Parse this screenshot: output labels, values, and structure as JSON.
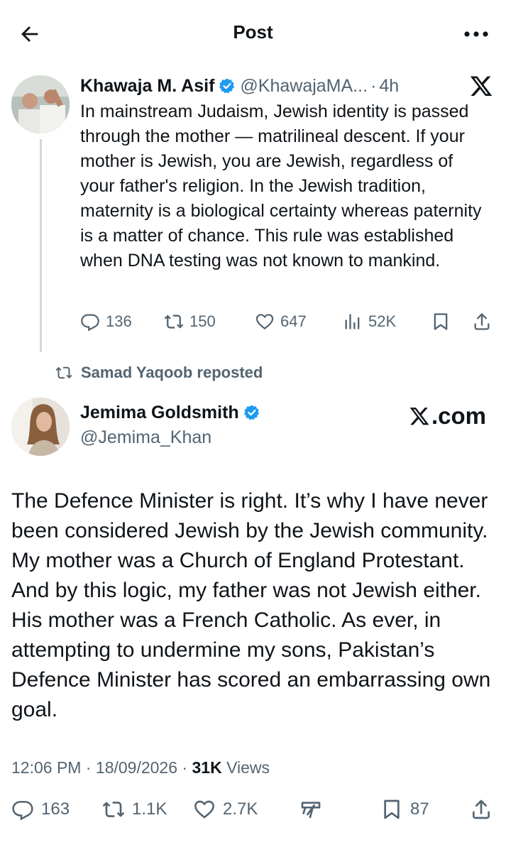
{
  "header": {
    "title": "Post"
  },
  "parent_post": {
    "author_name": "Khawaja M. Asif",
    "handle": "@KhawajaMA...",
    "separator": "·",
    "time": "4h",
    "text": "In mainstream Judaism, Jewish identity is passed through the mother — matrilineal descent. If your mother is Jewish, you are Jewish, regardless of your father's religion. In the Jewish tradition, maternity is a biological certainty whereas paternity is a matter of chance. This rule was established when DNA testing was not known to mankind.",
    "replies": "136",
    "reposts": "150",
    "likes": "647",
    "views": "52K"
  },
  "repost_notice": "Samad Yaqoob reposted",
  "main_post": {
    "author_name": "Jemima Goldsmith",
    "handle": "@Jemima_Khan",
    "watermark": ".com",
    "text": "The Defence Minister is right. It’s why I have never been considered Jewish by the Jewish community. My mother was a Church of England Protestant. And by this logic, my father was not Jewish either. His mother was a French Catholic. As ever, in attempting to undermine my sons, Pakistan’s Defence Minister has scored an embarrassing own goal.",
    "time": "12:06 PM",
    "date": "18/09/2026",
    "dot": "·",
    "views_count": "31K",
    "views_label": "Views",
    "replies": "163",
    "reposts": "1.1K",
    "likes": "2.7K",
    "bookmarks": "87"
  },
  "colors": {
    "text": "#0f1419",
    "muted": "#536471",
    "verified": "#1d9bf0",
    "thread_line": "#cfd9de"
  },
  "icons": [
    "back-arrow-icon",
    "more-icon",
    "verified-badge-icon",
    "x-logo-icon",
    "reply-icon",
    "repost-icon",
    "like-icon",
    "views-icon",
    "bookmark-icon",
    "share-icon",
    "grok-icon"
  ]
}
